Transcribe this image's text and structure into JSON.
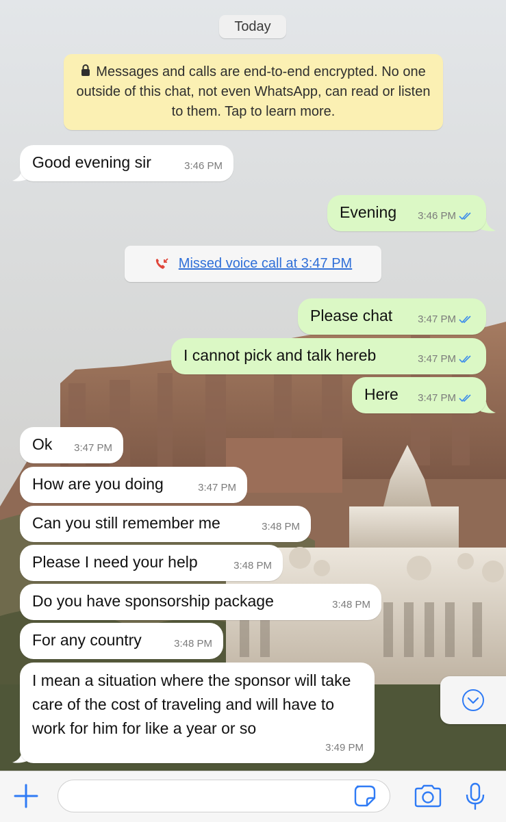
{
  "date_label": "Today",
  "encryption_notice": "Messages and calls are end-to-end encrypted. No one outside of this chat, not even WhatsApp, can read or listen to them. Tap to learn more.",
  "missed_call": "Missed voice call at 3:47 PM",
  "messages": [
    {
      "dir": "in",
      "text": "Good evening sir",
      "time": "3:46 PM"
    },
    {
      "dir": "out",
      "text": "Evening",
      "time": "3:46 PM"
    },
    {
      "dir": "out",
      "text": "Please chat",
      "time": "3:47 PM"
    },
    {
      "dir": "out",
      "text": "I cannot pick and talk hereb",
      "time": "3:47 PM"
    },
    {
      "dir": "out",
      "text": "Here",
      "time": "3:47 PM"
    },
    {
      "dir": "in",
      "text": "Ok",
      "time": "3:47 PM"
    },
    {
      "dir": "in",
      "text": "How are you doing",
      "time": "3:47 PM"
    },
    {
      "dir": "in",
      "text": "Can you still remember me",
      "time": "3:48 PM"
    },
    {
      "dir": "in",
      "text": "Please I need your help",
      "time": "3:48 PM"
    },
    {
      "dir": "in",
      "text": "Do you have sponsorship package",
      "time": "3:48 PM"
    },
    {
      "dir": "in",
      "text": "For any country",
      "time": "3:48 PM"
    },
    {
      "dir": "in",
      "text": "I mean a situation where the sponsor will take care of the cost of traveling and will have to work for him for like a year or so",
      "time": "3:49 PM"
    }
  ],
  "input": {
    "placeholder": "",
    "value": ""
  },
  "colors": {
    "incoming": "#ffffff",
    "outgoing": "#dbf8c5",
    "notice": "#fbf0b3",
    "accent": "#2f7bf5",
    "read_ticks": "#3b8beb",
    "missed_call_icon": "#e0463a"
  },
  "icons": [
    "lock-icon",
    "missed-call-icon",
    "read-ticks-icon",
    "scroll-down-icon",
    "plus-icon",
    "sticker-icon",
    "camera-icon",
    "mic-icon"
  ]
}
